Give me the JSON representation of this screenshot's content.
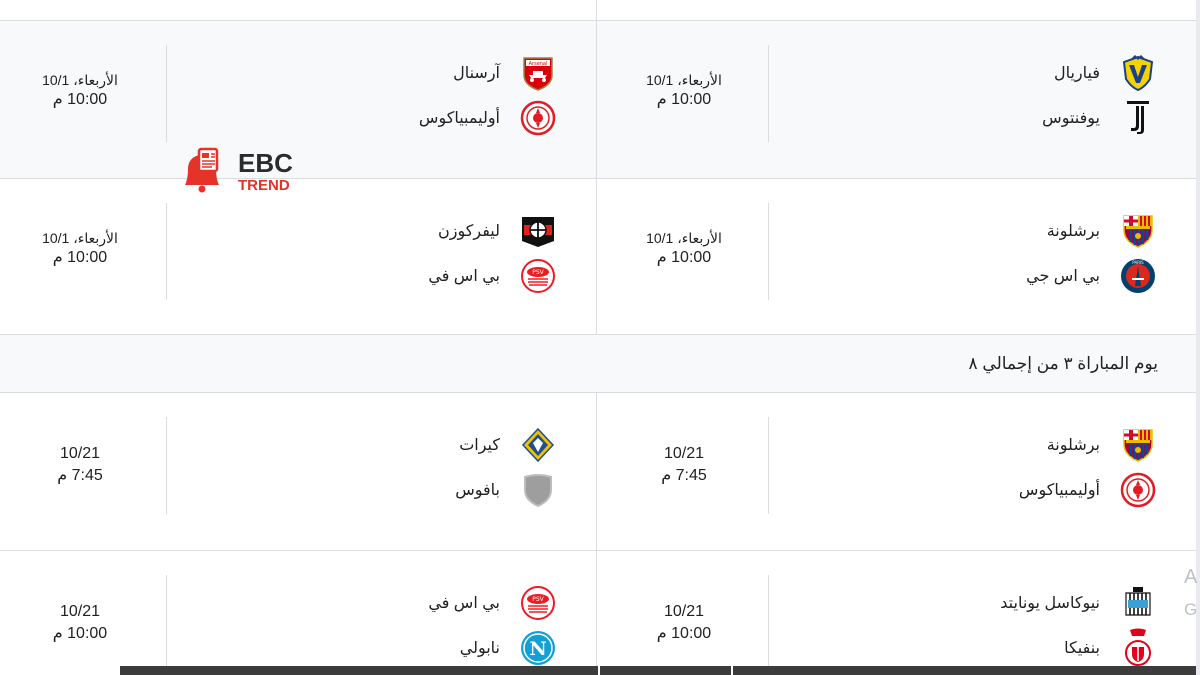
{
  "watermark": {
    "line1": "EBC",
    "line2": "TREND"
  },
  "sections": [
    {
      "grey": true,
      "right": {
        "home": "فياريال",
        "away": "يوفنتوس",
        "day": "الأربعاء، 10/1",
        "hour": "10:00 م"
      },
      "left": {
        "home": "آرسنال",
        "away": "أوليمبياكوس",
        "day": "الأربعاء، 10/1",
        "hour": "10:00 م"
      }
    },
    {
      "right": {
        "home": "برشلونة",
        "away": "بي اس جي",
        "day": "الأربعاء، 10/1",
        "hour": "10:00 م"
      },
      "left": {
        "home": "ليفركوزن",
        "away": "بي اس في",
        "day": "الأربعاء، 10/1",
        "hour": "10:00 م"
      }
    },
    {
      "matchday_label": "يوم المباراة ٣ من إجمالي ٨"
    },
    {
      "right": {
        "home": "برشلونة",
        "away": "أوليمبياكوس",
        "day": "10/21",
        "hour": "7:45 م"
      },
      "left": {
        "home": "كيرات",
        "away": "بافوس",
        "day": "10/21",
        "hour": "7:45 م"
      }
    },
    {
      "right": {
        "home": "نيوكاسل يونايتد",
        "away": "بنفيكا",
        "day": "10/21",
        "hour": "10:00 م"
      },
      "left": {
        "home": "بي اس في",
        "away": "نابولي",
        "day": "10/21",
        "hour": "10:00 م"
      }
    }
  ],
  "side_letters": [
    "A",
    "G"
  ],
  "logos": {
    "villarreal": "villarreal-crest-icon",
    "juventus": "juventus-crest-icon",
    "arsenal": "arsenal-crest-icon",
    "olympiacos": "olympiacos-crest-icon",
    "barcelona": "barcelona-crest-icon",
    "psg": "psg-crest-icon",
    "leverkusen": "leverkusen-crest-icon",
    "psv": "psv-crest-icon",
    "kairat": "kairat-crest-icon",
    "pafos": "pafos-crest-icon",
    "newcastle": "newcastle-crest-icon",
    "benfica": "benfica-crest-icon",
    "napoli": "napoli-crest-icon"
  }
}
